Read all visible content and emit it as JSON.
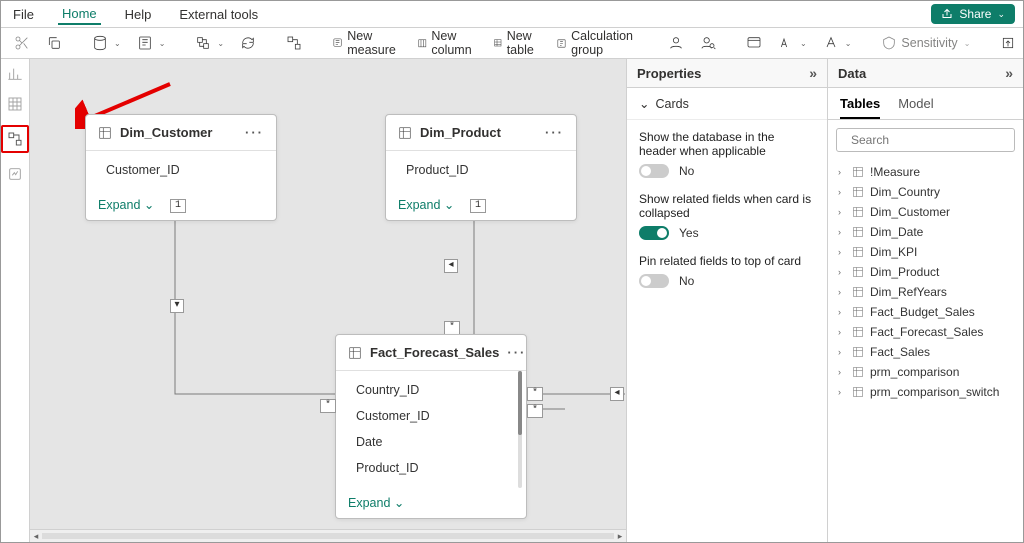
{
  "menu": {
    "file": "File",
    "home": "Home",
    "help": "Help",
    "ext": "External tools",
    "share": "Share"
  },
  "ribbon": {
    "new_measure": "New measure",
    "new_column": "New column",
    "new_table": "New table",
    "calc_group": "Calculation group",
    "sensitivity": "Sensitivity"
  },
  "canvas": {
    "expand": "Expand",
    "cards": {
      "customer": {
        "title": "Dim_Customer",
        "fields": [
          "Customer_ID"
        ]
      },
      "product": {
        "title": "Dim_Product",
        "fields": [
          "Product_ID"
        ]
      },
      "forecast": {
        "title": "Fact_Forecast_Sales",
        "fields": [
          "Country_ID",
          "Customer_ID",
          "Date",
          "Product_ID"
        ]
      }
    },
    "markers": {
      "one": "1",
      "many": "*",
      "chev": "◂",
      "chevR": "▸",
      "filter": "▾"
    }
  },
  "props": {
    "title": "Properties",
    "section": "Cards",
    "p1": "Show the database in the header when applicable",
    "v1": "No",
    "p2": "Show related fields when card is collapsed",
    "v2": "Yes",
    "p3": "Pin related fields to top of card",
    "v3": "No"
  },
  "data": {
    "title": "Data",
    "tab1": "Tables",
    "tab2": "Model",
    "search_ph": "Search",
    "tables": [
      "!Measure",
      "Dim_Country",
      "Dim_Customer",
      "Dim_Date",
      "Dim_KPI",
      "Dim_Product",
      "Dim_RefYears",
      "Fact_Budget_Sales",
      "Fact_Forecast_Sales",
      "Fact_Sales",
      "prm_comparison",
      "prm_comparison_switch"
    ]
  }
}
